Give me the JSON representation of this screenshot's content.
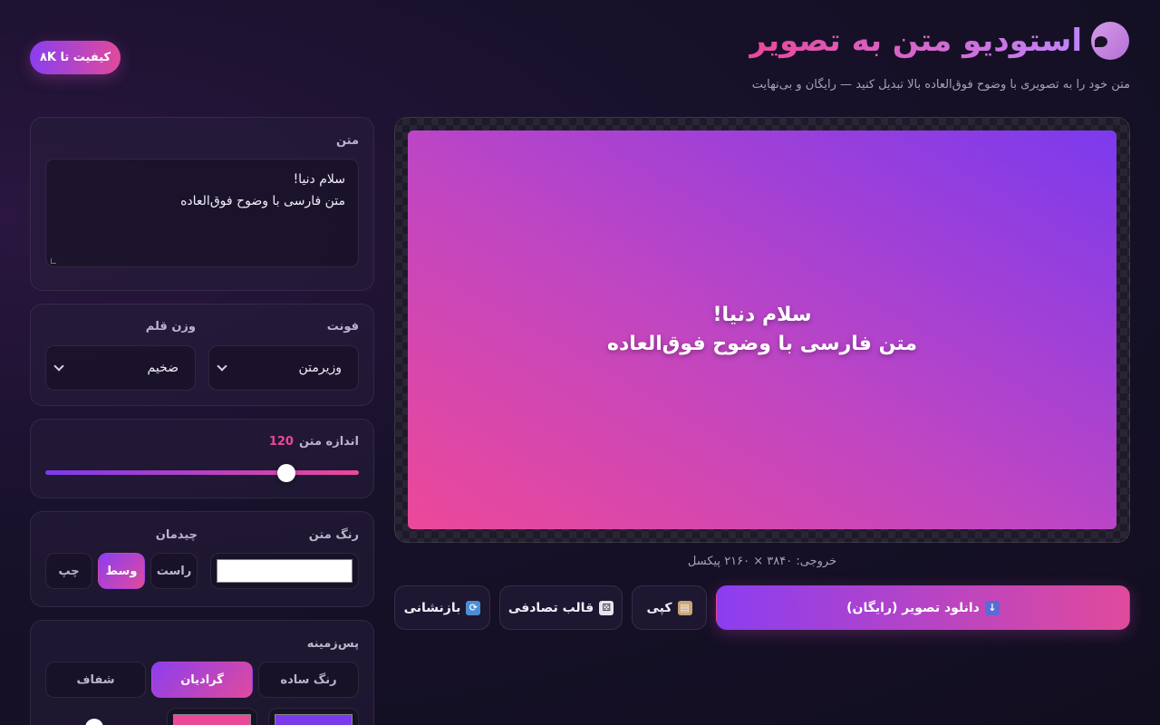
{
  "header": {
    "title": "استودیو متن به تصویر",
    "subtitle": "متن خود را به تصویری با وضوح فوق‌العاده بالا تبدیل کنید — رایگان و بی‌نهایت",
    "quality_badge": "کیفیت تا ۸K",
    "logo_icon": "palette-icon"
  },
  "text_panel": {
    "label": "متن",
    "value": "سلام دنیا!\nمتن فارسی با وضوح فوق‌العاده"
  },
  "font_panel": {
    "font_label": "فونت",
    "font_value": "وزیرمتن",
    "weight_label": "وزن قلم",
    "weight_value": "ضخیم"
  },
  "size_panel": {
    "label": "اندازه متن",
    "value": "120",
    "value_fraction": 0.77,
    "value_color": "#ec4899"
  },
  "color_align_panel": {
    "color_label": "رنگ متن",
    "color_value": "#ffffff",
    "align_label": "چیدمان",
    "align_options": [
      "راست",
      "وسط",
      "چپ"
    ],
    "align_selected": "وسط"
  },
  "background_panel": {
    "label": "پس‌زمینه",
    "options": [
      "رنگ ساده",
      "گرادیان",
      "شفاف"
    ],
    "selected": "گرادیان",
    "gradient_colors": [
      "#7c3aed",
      "#ec4899"
    ]
  },
  "preview": {
    "text": "سلام دنیا!\nمتن فارسی با وضوح فوق‌العاده",
    "output_info": "خروجی: ۳۸۴۰ × ۲۱۶۰ پیکسل"
  },
  "actions": {
    "download": "دانلود تصویر (رایگان)",
    "download_icon": "⬇️",
    "copy": "کپی",
    "copy_icon": "📋",
    "random": "قالب تصادفی",
    "random_icon": "🎲",
    "reset": "بازنشانی",
    "reset_icon": "🔄"
  },
  "colors": {
    "accent_purple": "#8b3ef0",
    "accent_pink": "#e04a9c"
  }
}
